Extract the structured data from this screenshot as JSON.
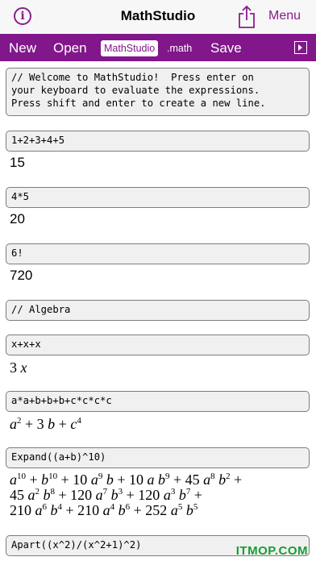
{
  "app": {
    "title": "MathStudio",
    "menu_label": "Menu"
  },
  "toolbar": {
    "new_label": "New",
    "open_label": "Open",
    "file_name": "MathStudio",
    "file_ext": ".math",
    "save_label": "Save"
  },
  "icons": {
    "info": "info-icon",
    "share": "share-icon",
    "panel": "panel-toggle-icon"
  },
  "colors": {
    "accent": "#81178a"
  },
  "cells": [
    {
      "input": "// Welcome to MathStudio!  Press enter on\nyour keyboard to evaluate the expressions.\nPress shift and enter to create a new line."
    },
    {
      "input": "1+2+3+4+5",
      "output": "15"
    },
    {
      "input": "4*5",
      "output": "20"
    },
    {
      "input": "6!",
      "output": "720"
    },
    {
      "input": "// Algebra"
    },
    {
      "input": "x+x+x",
      "output": "3x"
    },
    {
      "input": "a*a+b+b+b+c*c*c*c",
      "output": "a^2 + 3b + c^4"
    },
    {
      "input": "Expand((a+b)^10)",
      "output": "a^10 + b^10 + 10a^9b + 10ab^9 + 45a^8b^2 + 45a^2b^8 + 120a^7b^3 + 120a^3b^7 + 210a^6b^4 + 210a^4b^6 + 252a^5b^5"
    },
    {
      "input": "Apart((x^2)/(x^2+1)^2)"
    }
  ],
  "watermark": "ITMOP.COM"
}
